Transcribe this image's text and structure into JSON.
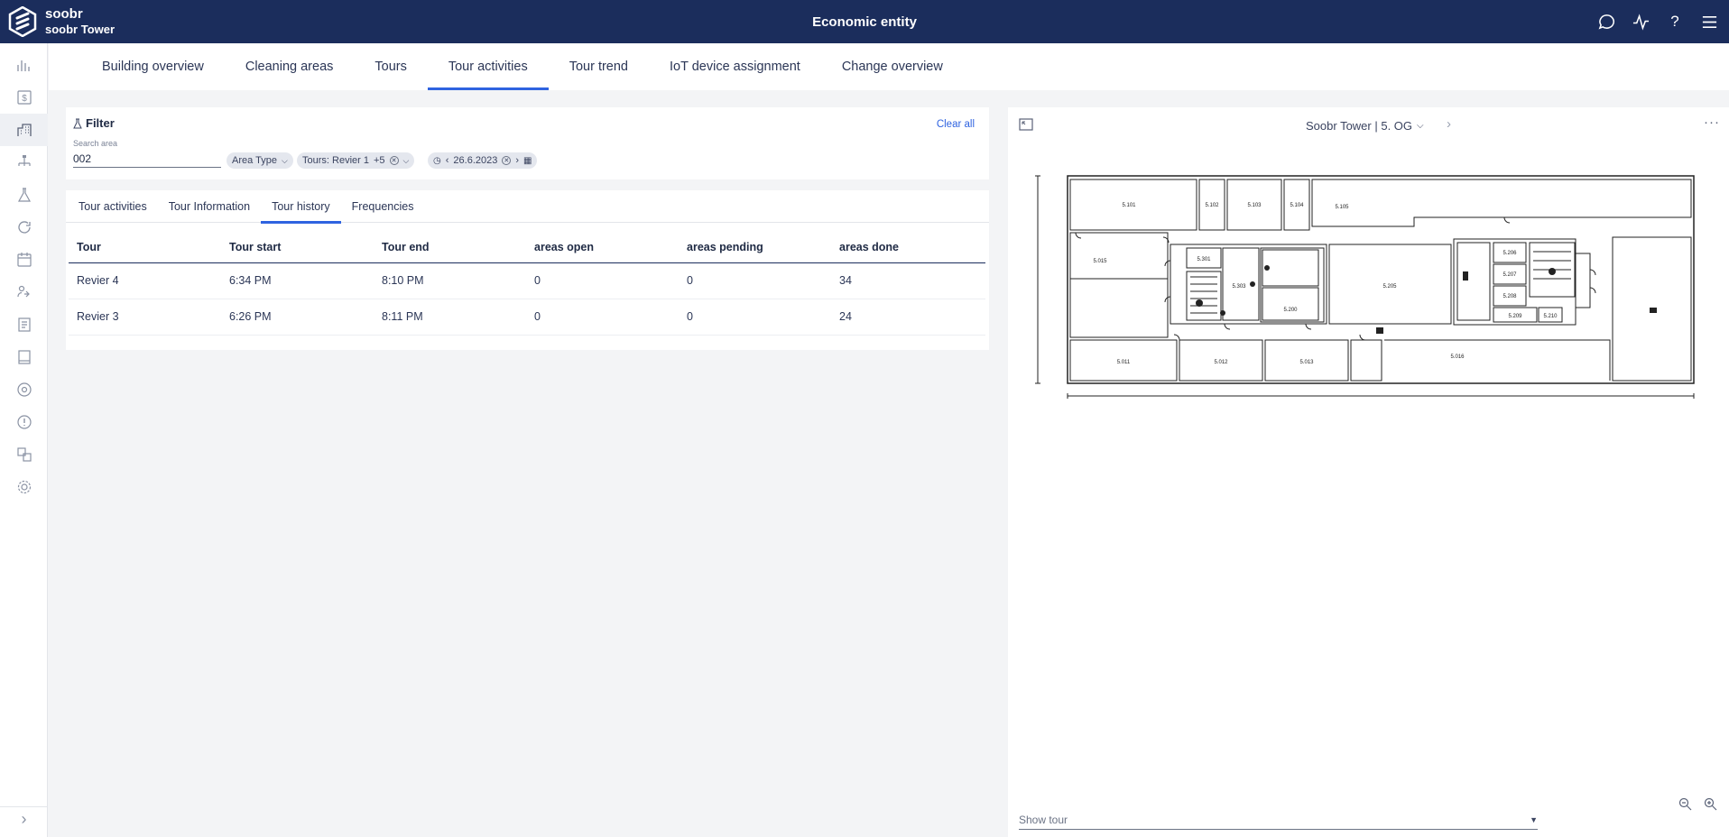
{
  "header": {
    "brand_name": "soobr",
    "brand_sub": "soobr Tower",
    "title": "Economic entity",
    "icons": [
      "chat-icon",
      "activity-icon",
      "help-icon",
      "menu-icon"
    ]
  },
  "rail": {
    "icons": [
      "bar-chart-icon",
      "dollar-icon",
      "building-icon",
      "hierarchy-icon",
      "flask-icon",
      "refresh-icon",
      "calendar-clock-icon",
      "users-swap-icon",
      "report-icon",
      "book-icon",
      "gauge-icon",
      "alert-icon",
      "translate-icon",
      "settings-icon"
    ],
    "active_index": 2
  },
  "nav": {
    "tabs": [
      {
        "label": "Building overview"
      },
      {
        "label": "Cleaning areas"
      },
      {
        "label": "Tours"
      },
      {
        "label": "Tour activities"
      },
      {
        "label": "Tour trend"
      },
      {
        "label": "IoT device assignment"
      },
      {
        "label": "Change overview"
      }
    ],
    "active": "Tour activities"
  },
  "filter": {
    "title": "Filter",
    "clear_all": "Clear all",
    "search_label": "Search area",
    "search_value": "002",
    "area_type": "Area Type",
    "tours_chip": "Tours: Revier 1",
    "tours_more": "+5",
    "date": "26.6.2023"
  },
  "subtabs": {
    "items": [
      {
        "label": "Tour activities"
      },
      {
        "label": "Tour Information"
      },
      {
        "label": "Tour history"
      },
      {
        "label": "Frequencies"
      }
    ],
    "active": "Tour history"
  },
  "table": {
    "columns": [
      "Tour",
      "Tour start",
      "Tour end",
      "areas open",
      "areas pending",
      "areas done"
    ],
    "rows": [
      [
        "Revier 4",
        "6:34 PM",
        "8:10 PM",
        "0",
        "0",
        "34"
      ],
      [
        "Revier 3",
        "6:26 PM",
        "8:11 PM",
        "0",
        "0",
        "24"
      ]
    ]
  },
  "map": {
    "selector": "Soobr Tower | 5. OG",
    "show_tour_placeholder": "Show tour",
    "room_labels": [
      "5.101",
      "5.102",
      "5.103",
      "5.104",
      "5.105",
      "5.015",
      "5.301",
      "5.303",
      "5.200",
      "5.205",
      "5.206",
      "5.207",
      "5.208",
      "5.209",
      "5.210",
      "5.011",
      "5.012",
      "5.013",
      "5.016"
    ]
  },
  "colors": {
    "header_bg": "#1b2d5c",
    "accent": "#2f63e0"
  }
}
